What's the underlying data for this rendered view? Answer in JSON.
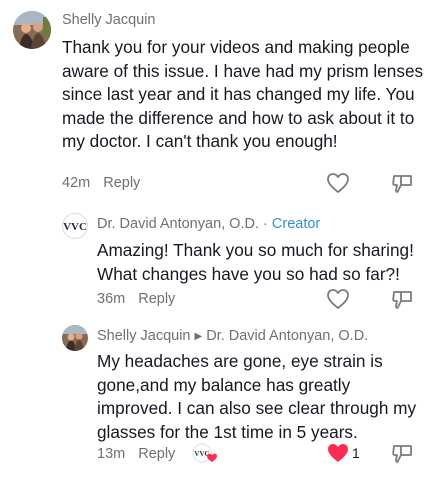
{
  "comments": [
    {
      "author": "Shelly Jacquin",
      "text": "Thank you for your videos and making people aware of this issue. I have had my prism lenses since last year and it has changed my life. You made the difference and how to ask about it to my doctor. I can't thank you enough!",
      "time": "42m",
      "reply_label": "Reply"
    },
    {
      "author": "Dr. David Antonyan, O.D.",
      "separator": " · ",
      "badge": "Creator",
      "text": "Amazing! Thank you so much for sharing! What changes have you so had so far?!",
      "time": "36m",
      "reply_label": "Reply"
    },
    {
      "author": "Shelly Jacquin",
      "reply_to": "Dr. David Antonyan, O.D.",
      "text": "My headaches are gone, eye strain is gone,and my balance has greatly improved. I can also see clear through my glasses for the 1st time in 5 years.",
      "time": "13m",
      "reply_label": "Reply",
      "like_count": "1",
      "liked_color": "#fe2c55"
    }
  ],
  "icons": {
    "like": "heart-outline-icon",
    "liked": "heart-filled-icon",
    "dislike": "thumbs-down-icon",
    "reply_arrow": "triangle-right-icon",
    "creator_liked": "creator-avatar-heart-badge"
  },
  "colors": {
    "secondary_text": "#6f7075",
    "creator_badge": "#2f8fd4",
    "liked_heart": "#fe2c55"
  }
}
